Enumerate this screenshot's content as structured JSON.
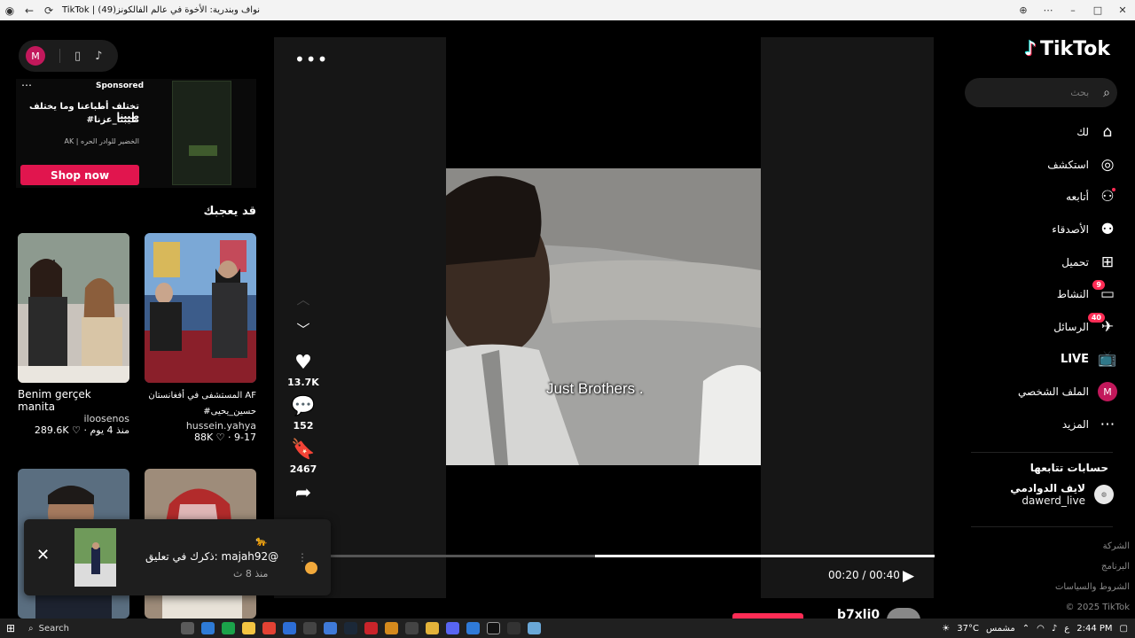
{
  "browser": {
    "title": "TikTok | نواف وبندرية: الأخوة في عالم الفالكونز(49)",
    "buttons": [
      "back",
      "refresh"
    ]
  },
  "nav": {
    "logo_text": "TikTok",
    "search_placeholder": "بحث",
    "items": [
      {
        "label": "لك",
        "icon": "home-icon"
      },
      {
        "label": "استكشف",
        "icon": "compass-icon"
      },
      {
        "label": "أتابعه",
        "icon": "user-follow-icon"
      },
      {
        "label": "الأصدقاء",
        "icon": "friends-icon"
      },
      {
        "label": "تحميل",
        "icon": "upload-icon"
      },
      {
        "label": "النشاط",
        "icon": "activity-icon",
        "badge": "9"
      },
      {
        "label": "الرسائل",
        "icon": "messages-icon",
        "badge": "40"
      },
      {
        "label": "LIVE",
        "icon": "live-icon"
      },
      {
        "label": "الملف الشخصي",
        "icon": "profile-avatar",
        "avatar_letter": "M"
      },
      {
        "label": "المزيد",
        "icon": "more-icon"
      }
    ],
    "following_title": "حسابات تتابعها",
    "following_account": {
      "name": "لايف الدوادمي",
      "handle": "dawerd_live"
    },
    "footer": [
      "الشركة",
      "البرنامج",
      "الشروط والسياسات",
      "© 2025 TikTok"
    ]
  },
  "player": {
    "caption": "Just Brothers .",
    "time": "00:20 / 00:40",
    "progress_fraction": 0.56,
    "likes": "13.7K",
    "comments": "152",
    "saves": "2467",
    "bottom_username": "b7xli0"
  },
  "left": {
    "avatar_letter": "M",
    "ad": {
      "sponsored": "Sponsored",
      "line1": "تختلف أطباعنا وما يختلف طيبنا",
      "line2": "#طيبنا_عزنا",
      "line3": "AK | الخضير للوادر الحره",
      "cta": "Shop now"
    },
    "suggest_title": "قد يعجبك",
    "cards": [
      {
        "title": "Benim gerçek manita",
        "author": "iloosenos",
        "meta": "289.6K ♡ · منذ 4 يوم"
      },
      {
        "title": "المستشفى في أفغانستان AF #حسين_يحيى",
        "author": "hussein.yahya",
        "meta": "88K ♡ · 9-17"
      }
    ]
  },
  "toast": {
    "message": "ذكرك في تعليق: majah92@",
    "time": "منذ 8 ث"
  },
  "taskbar": {
    "search": "Search",
    "weather": "37°C",
    "weather_label": "مشمس",
    "lang": "ع",
    "clock": "2:44 PM"
  }
}
